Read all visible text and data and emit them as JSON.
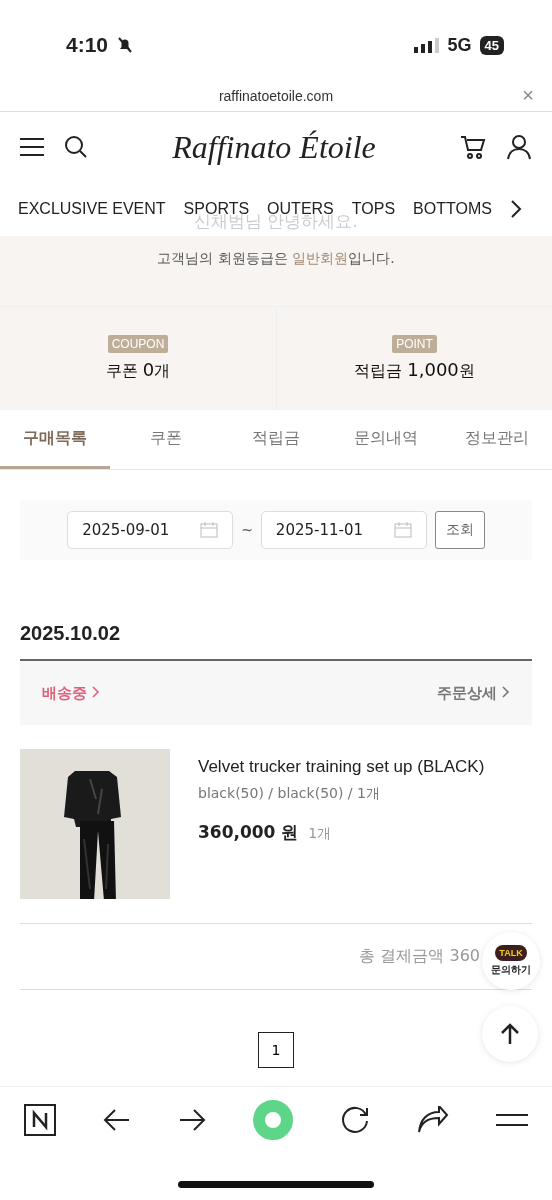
{
  "status_bar": {
    "time": "4:10",
    "network": "5G",
    "battery": "45"
  },
  "url_bar": {
    "url": "raffinatoetoile.com",
    "close": "×"
  },
  "header": {
    "logo": "Raffinato Étoile"
  },
  "nav": {
    "items": [
      "EXCLUSIVE EVENT",
      "SPORTS",
      "OUTERS",
      "TOPS",
      "BOTTOMS"
    ]
  },
  "greeting": {
    "name_line": "신채범님 안녕하세요.",
    "grade_before": "고객님의 회원등급은 ",
    "grade": "일반회원",
    "grade_after": "입니다."
  },
  "benefits": [
    {
      "badge": "COUPON",
      "label": "쿠폰 ",
      "value": "0",
      "unit": "개"
    },
    {
      "badge": "POINT",
      "label": "적립금 ",
      "value": "1,000",
      "unit": "원"
    }
  ],
  "tabs": [
    {
      "label": "구매목록",
      "selected": true
    },
    {
      "label": "쿠폰",
      "selected": false
    },
    {
      "label": "적립금",
      "selected": false
    },
    {
      "label": "문의내역",
      "selected": false
    },
    {
      "label": "정보관리",
      "selected": false
    }
  ],
  "date_filter": {
    "from": "2025-09-01",
    "separator": "~",
    "to": "2025-11-01",
    "button": "조회"
  },
  "orders": [
    {
      "date": "2025.10.02",
      "status": "배송중",
      "detail": "주문상세",
      "items": [
        {
          "name": "Velvet trucker training set up (BLACK)",
          "option": "black(50) / black(50) / 1개",
          "price": "360,000 원",
          "qty": "1개"
        }
      ],
      "total": "총 결제금액 360"
    }
  ],
  "floating": {
    "talk": "TALK",
    "talk_label": "문의하기"
  },
  "pagination": {
    "pages": [
      {
        "label": "1",
        "selected": true
      }
    ]
  }
}
